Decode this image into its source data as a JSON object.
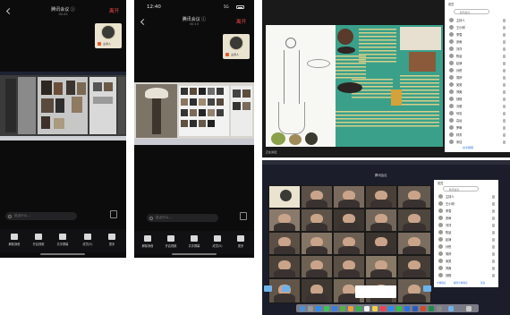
{
  "phone1": {
    "meeting_title": "腾讯会议 ⓘ",
    "duration": "00:45",
    "leave_label": "离开",
    "avatar_name": "主持人",
    "chat_placeholder": "说点什么...",
    "toolbar": [
      "解除静音",
      "开启视频",
      "共享屏幕",
      "成员(5)",
      "更多"
    ]
  },
  "phone2": {
    "time": "12:40",
    "signal": "5G",
    "meeting_title": "腾讯会议 ⓘ",
    "duration": "00:15",
    "leave_label": "离开",
    "avatar_name": "主持人",
    "chat_placeholder": "说点什么...",
    "toolbar": [
      "解除静音",
      "开启视频",
      "共享屏幕",
      "成员(5)",
      "更多"
    ]
  },
  "desktop1": {
    "panel_title": "成员",
    "panel_search": "腾讯会议",
    "panel_members": [
      "主持人",
      "王小明",
      "李雪",
      "张雨",
      "刘洋",
      "陈晨",
      "赵静",
      "孙悦",
      "周婷",
      "吴昊",
      "郑爽",
      "钱程",
      "冯丽",
      "何欢",
      "高远",
      "罗琳",
      "林芳",
      "宋佳"
    ],
    "footer_left": "正在讲话：",
    "footer_right": "共享屏幕"
  },
  "desktop2": {
    "meeting_title": "腾讯会议",
    "panel_title": "成员",
    "panel_search": "腾讯会议",
    "panel_members": [
      "主持人",
      "王小明",
      "李雪",
      "张雨",
      "刘洋",
      "陈晨",
      "赵静",
      "孙悦",
      "周婷",
      "吴昊",
      "郑爽",
      "钱程",
      "冯丽"
    ],
    "panel_actions": [
      "全体静音",
      "解除全体静音",
      "更多"
    ]
  },
  "colors": {
    "phone_bg": "#0c0c0d",
    "leave_red": "#f04a4a",
    "slide_green": "#3aa08a",
    "accent_blue": "#2b6fe0"
  }
}
